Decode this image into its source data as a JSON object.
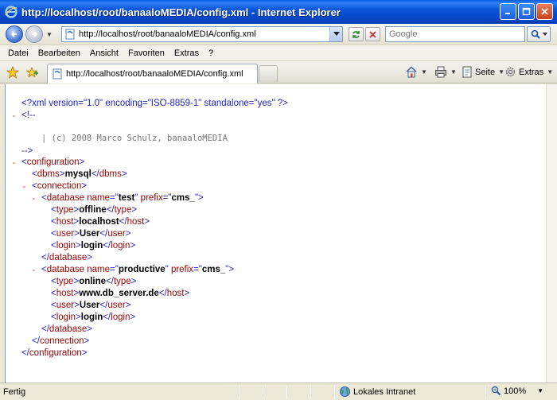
{
  "window": {
    "title": "http://localhost/root/banaaloMEDIA/config.xml - Internet Explorer"
  },
  "addressbar": {
    "url": "http://localhost/root/banaaloMEDIA/config.xml"
  },
  "search": {
    "placeholder": "Google"
  },
  "menu": {
    "items": [
      "Datei",
      "Bearbeiten",
      "Ansicht",
      "Favoriten",
      "Extras",
      "?"
    ]
  },
  "tab": {
    "label": "http://localhost/root/banaaloMEDIA/config.xml"
  },
  "commands": {
    "page_label": "Seite",
    "tools_label": "Extras"
  },
  "xml": {
    "declaration": "<?xml version=\"1.0\" encoding=\"ISO-8859-1\" standalone=\"yes\" ?>",
    "comment_open": "<!--",
    "comment_text": "| (c) 2008 Marco Schulz, banaaloMEDIA",
    "comment_close": "-->",
    "root_tag": "configuration",
    "dbms_tag": "dbms",
    "dbms_value": "mysql",
    "connection_tag": "connection",
    "database_tag": "database",
    "attr_name": "name",
    "attr_prefix": "prefix",
    "databases": [
      {
        "name": "test",
        "prefix": "cms_",
        "fields": [
          {
            "tag": "type",
            "value": "offline"
          },
          {
            "tag": "host",
            "value": "localhost"
          },
          {
            "tag": "user",
            "value": "User"
          },
          {
            "tag": "login",
            "value": "login"
          }
        ]
      },
      {
        "name": "productive",
        "prefix": "cms_",
        "fields": [
          {
            "tag": "type",
            "value": "online"
          },
          {
            "tag": "host",
            "value": "www.db_server.de"
          },
          {
            "tag": "user",
            "value": "User"
          },
          {
            "tag": "login",
            "value": "login"
          }
        ]
      }
    ]
  },
  "statusbar": {
    "status": "Fertig",
    "zone": "Lokales Intranet",
    "zoom": "100%"
  },
  "colors": {
    "titlebar": "#0b56d9",
    "tag": "#990000",
    "bracket": "#2222cc",
    "collapse_minus": "#e03030"
  }
}
